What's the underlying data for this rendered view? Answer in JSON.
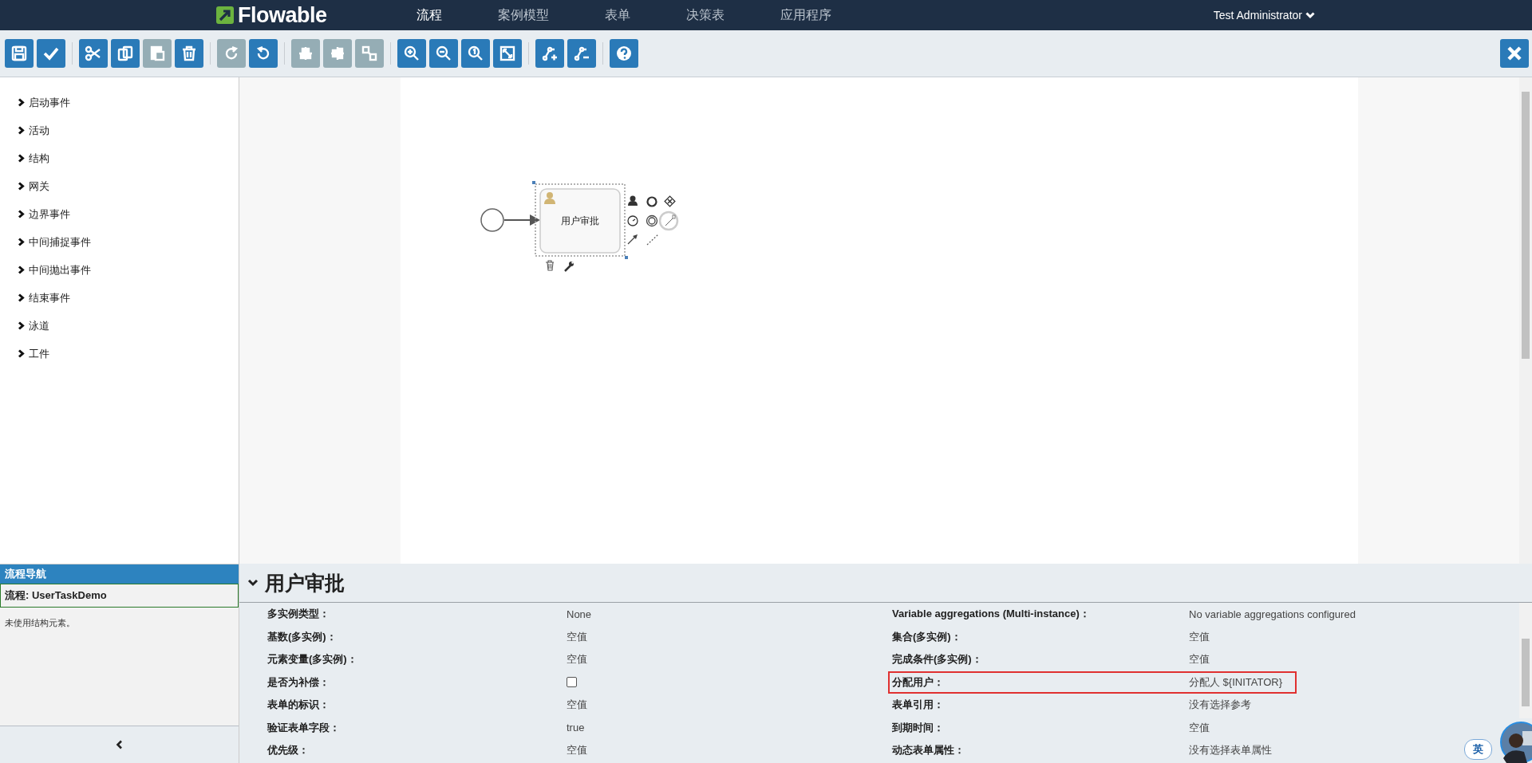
{
  "navbar": {
    "logo": "Flowable",
    "tabs": [
      {
        "label": "流程",
        "selected": true
      },
      {
        "label": "案例模型",
        "selected": false
      },
      {
        "label": "表单",
        "selected": false
      },
      {
        "label": "决策表",
        "selected": false
      },
      {
        "label": "应用程序",
        "selected": false
      }
    ],
    "user": "Test Administrator"
  },
  "toolbar": [
    [
      {
        "kind": "save",
        "disabled": false
      },
      {
        "kind": "validate",
        "disabled": false
      }
    ],
    [
      {
        "kind": "cut",
        "disabled": false
      },
      {
        "kind": "copy",
        "disabled": false
      },
      {
        "kind": "paste",
        "disabled": true
      },
      {
        "kind": "delete",
        "disabled": false
      }
    ],
    [
      {
        "kind": "redo",
        "disabled": true
      },
      {
        "kind": "undo",
        "disabled": false
      }
    ],
    [
      {
        "kind": "align-h",
        "disabled": true
      },
      {
        "kind": "align-v",
        "disabled": true
      },
      {
        "kind": "same-size",
        "disabled": true
      }
    ],
    [
      {
        "kind": "zoom-in",
        "disabled": false
      },
      {
        "kind": "zoom-out",
        "disabled": false
      },
      {
        "kind": "zoom-actual",
        "disabled": false
      },
      {
        "kind": "zoom-fit",
        "disabled": false
      }
    ],
    [
      {
        "kind": "bend-add",
        "disabled": false
      },
      {
        "kind": "bend-remove",
        "disabled": false
      }
    ],
    [
      {
        "kind": "help",
        "disabled": false
      }
    ]
  ],
  "palette": [
    {
      "label": "启动事件",
      "expanded": false
    },
    {
      "label": "活动",
      "expanded": false
    },
    {
      "label": "结构",
      "expanded": false
    },
    {
      "label": "网关",
      "expanded": false
    },
    {
      "label": "边界事件",
      "expanded": false
    },
    {
      "label": "中间捕捉事件",
      "expanded": false
    },
    {
      "label": "中间抛出事件",
      "expanded": false
    },
    {
      "label": "结束事件",
      "expanded": false
    },
    {
      "label": "泳道",
      "expanded": false
    },
    {
      "label": "工件",
      "expanded": false
    }
  ],
  "diagram": {
    "task": {
      "label": "用户审批",
      "selected": true
    }
  },
  "navigator": {
    "title": "流程导航",
    "process": "流程: UserTaskDemo",
    "message": "未使用结构元素。"
  },
  "properties": {
    "title": "用户审批",
    "expanded": true,
    "left": [
      {
        "kind": "text",
        "label": "多实例类型：",
        "value": "None",
        "highlighted": false
      },
      {
        "kind": "text",
        "label": "基数(多实例)：",
        "value": "空值",
        "highlighted": false
      },
      {
        "kind": "text",
        "label": "元素变量(多实例)：",
        "value": "空值",
        "highlighted": false
      },
      {
        "kind": "checkbox",
        "label": "是否为补偿：",
        "checked": false,
        "highlighted": false
      },
      {
        "kind": "text",
        "label": "表单的标识：",
        "value": "空值",
        "highlighted": false
      },
      {
        "kind": "text",
        "label": "验证表单字段：",
        "value": "true",
        "highlighted": false
      },
      {
        "kind": "text",
        "label": "优先级：",
        "value": "空值",
        "highlighted": false
      }
    ],
    "right": [
      {
        "kind": "text",
        "label": "Variable aggregations (Multi-instance)：",
        "value": "No variable aggregations configured",
        "highlighted": false
      },
      {
        "kind": "text",
        "label": "集合(多实例)：",
        "value": "空值",
        "highlighted": false
      },
      {
        "kind": "text",
        "label": "完成条件(多实例)：",
        "value": "空值",
        "highlighted": false
      },
      {
        "kind": "text",
        "label": "分配用户：",
        "value": "分配人 ${INITATOR}",
        "highlighted": true
      },
      {
        "kind": "text",
        "label": "表单引用：",
        "value": "没有选择参考",
        "highlighted": false
      },
      {
        "kind": "text",
        "label": "到期时间：",
        "value": "空值",
        "highlighted": false
      },
      {
        "kind": "text",
        "label": "动态表单属性：",
        "value": "没有选择表单属性",
        "highlighted": false
      }
    ]
  },
  "ime_indicator": "英"
}
